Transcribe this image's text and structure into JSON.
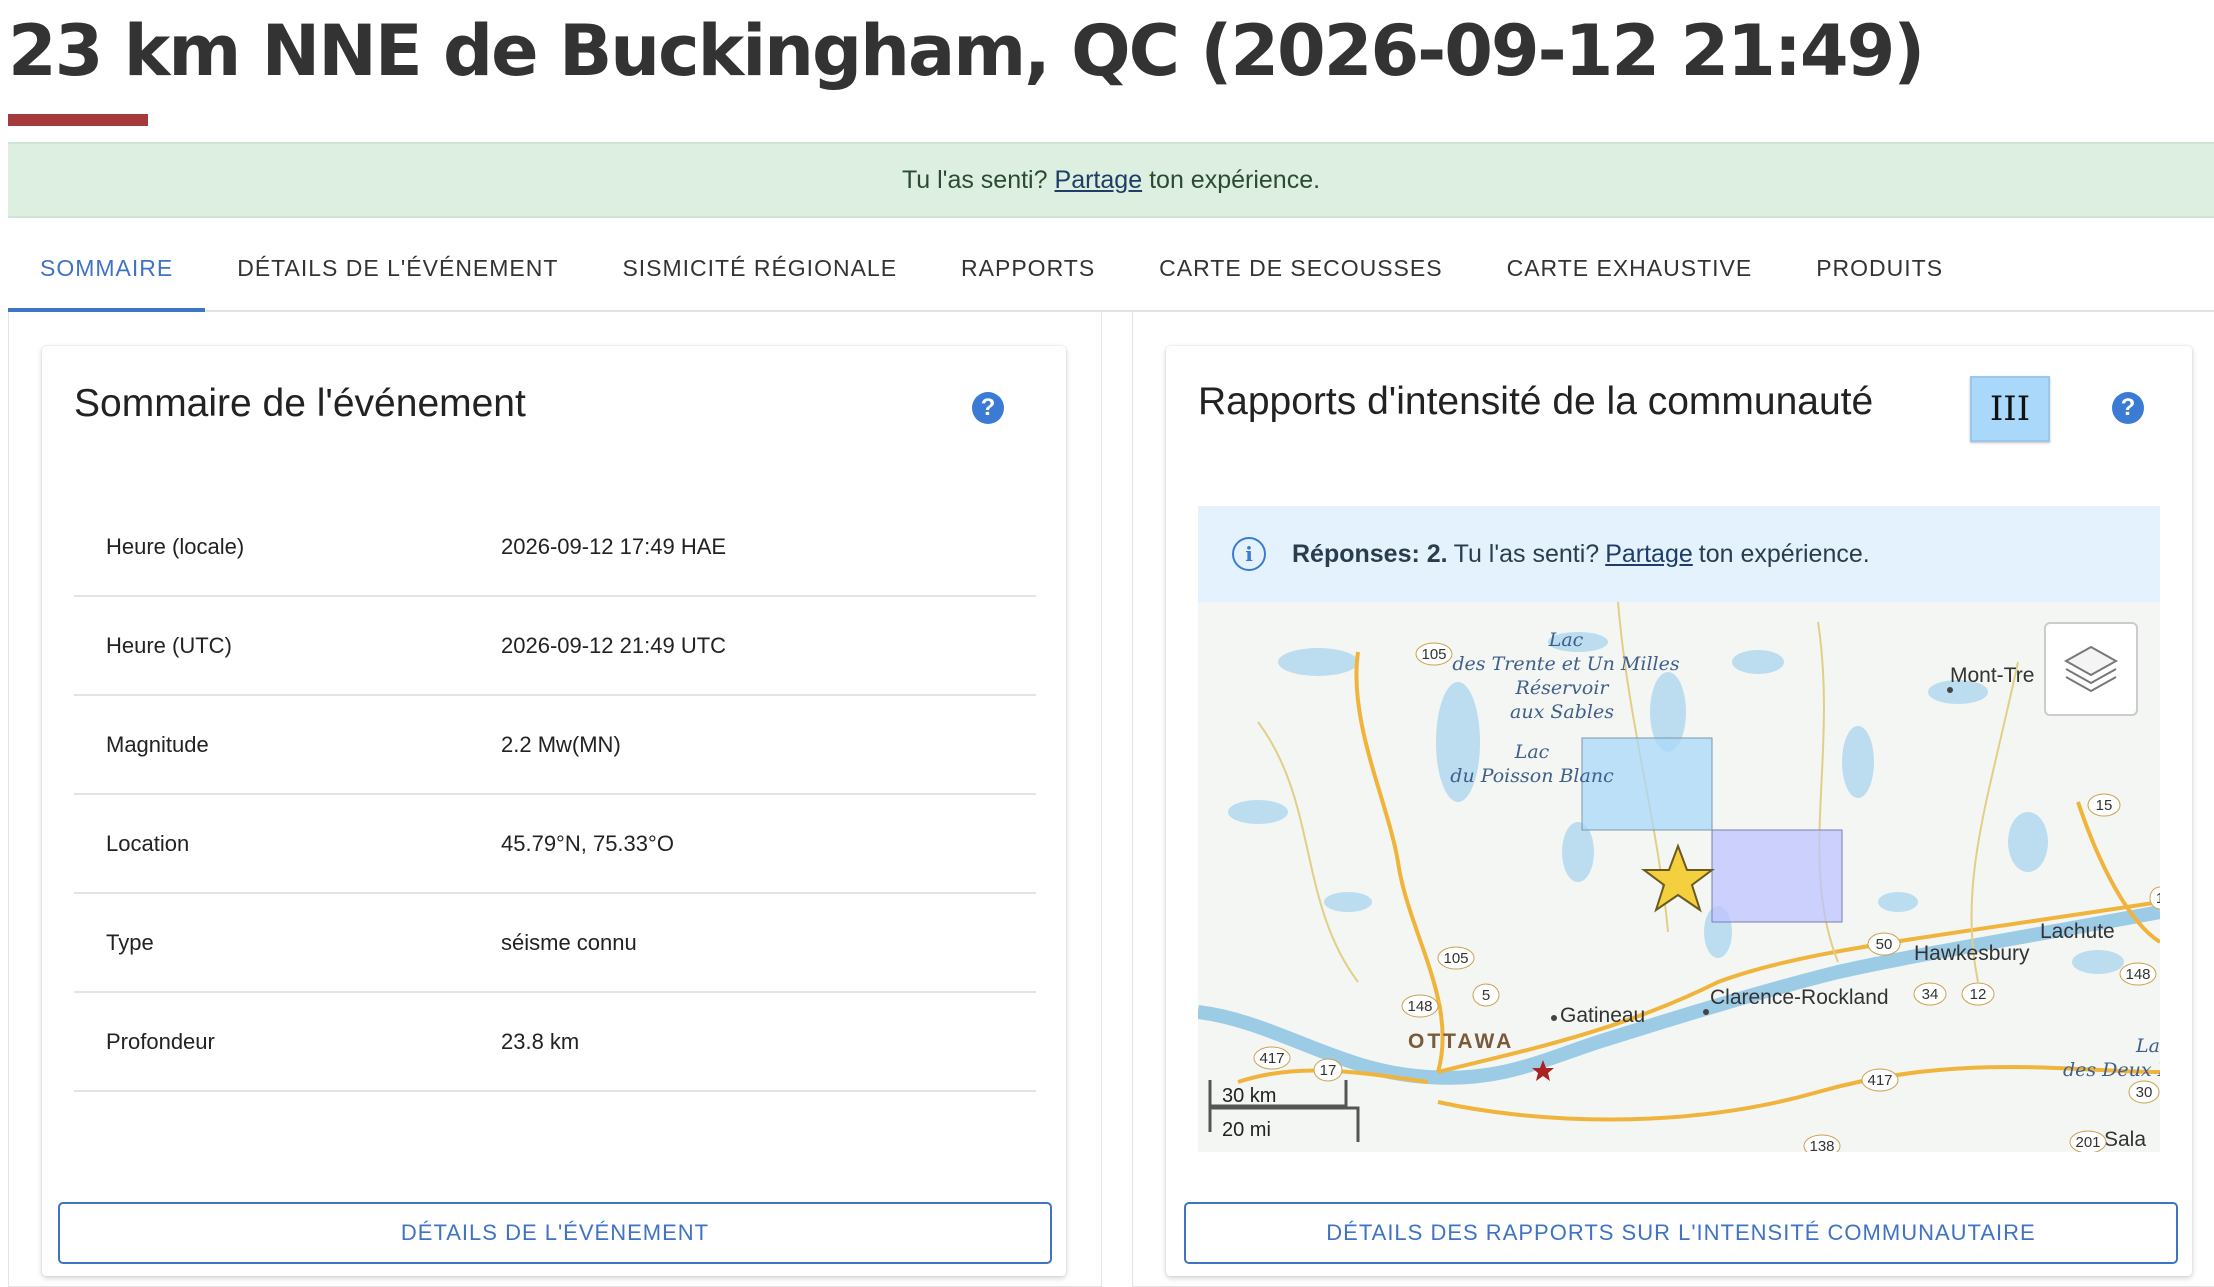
{
  "page_title": "23 km NNE de Buckingham, QC (2026-09-12 21:49)",
  "felt_banner": {
    "prefix": "Tu l'as senti?",
    "link": "Partage",
    "suffix": "ton expérience."
  },
  "tabs": [
    {
      "label": "SOMMAIRE",
      "active": true
    },
    {
      "label": "DÉTAILS DE L'ÉVÉNEMENT"
    },
    {
      "label": "SISMICITÉ RÉGIONALE"
    },
    {
      "label": "RAPPORTS"
    },
    {
      "label": "CARTE DE SECOUSSES"
    },
    {
      "label": "CARTE EXHAUSTIVE"
    },
    {
      "label": "PRODUITS"
    }
  ],
  "summary": {
    "title": "Sommaire de l'événement",
    "help": "?",
    "rows": [
      {
        "label": "Heure (locale)",
        "value": "2026-09-12 17:49 HAE"
      },
      {
        "label": "Heure (UTC)",
        "value": "2026-09-12 21:49 UTC"
      },
      {
        "label": "Magnitude",
        "value": "2.2 Mw(MN)"
      },
      {
        "label": "Location",
        "value": "45.79°N, 75.33°O"
      },
      {
        "label": "Type",
        "value": "séisme connu"
      },
      {
        "label": "Profondeur",
        "value": "23.8 km"
      }
    ],
    "button": "DÉTAILS DE L'ÉVÉNEMENT"
  },
  "dyfi": {
    "title": "Rapports d'intensité de la communauté",
    "intensity_badge": "III",
    "help": "?",
    "responses_label": "Réponses: 2.",
    "prefix": "Tu l'as senti?",
    "link": "Partage",
    "suffix": "ton expérience.",
    "button": "DÉTAILS DES RAPPORTS SUR L'INTENSITÉ COMMUNAUTAIRE"
  },
  "map": {
    "labels": {
      "lac1": "Lac",
      "lac1b": "des Trente et Un Milles",
      "reservoir": "Réservoir",
      "reservoir_b": "aux Sables",
      "lac2": "Lac",
      "lac2b": "du Poisson Blanc",
      "mont": "Mont-Tre",
      "lachute": "Lachute",
      "hawkesbury": "Hawkesbury",
      "clarence": "Clarence-Rockland",
      "gatineau": "Gatineau",
      "ottawa": "OTTAWA",
      "lac3": "La",
      "lac3b": "des Deux M",
      "sala": "Sala"
    },
    "routes": [
      "105",
      "15",
      "105",
      "5",
      "148",
      "50",
      "34",
      "12",
      "148",
      "417",
      "17",
      "417",
      "138",
      "201",
      "30",
      "1"
    ],
    "scale": {
      "km": "30 km",
      "mi": "20 mi"
    },
    "colors": {
      "cell_ii": "#aad8fa",
      "cell_iii": "#bdc4ff",
      "epicenter": "#f4d03f"
    }
  }
}
